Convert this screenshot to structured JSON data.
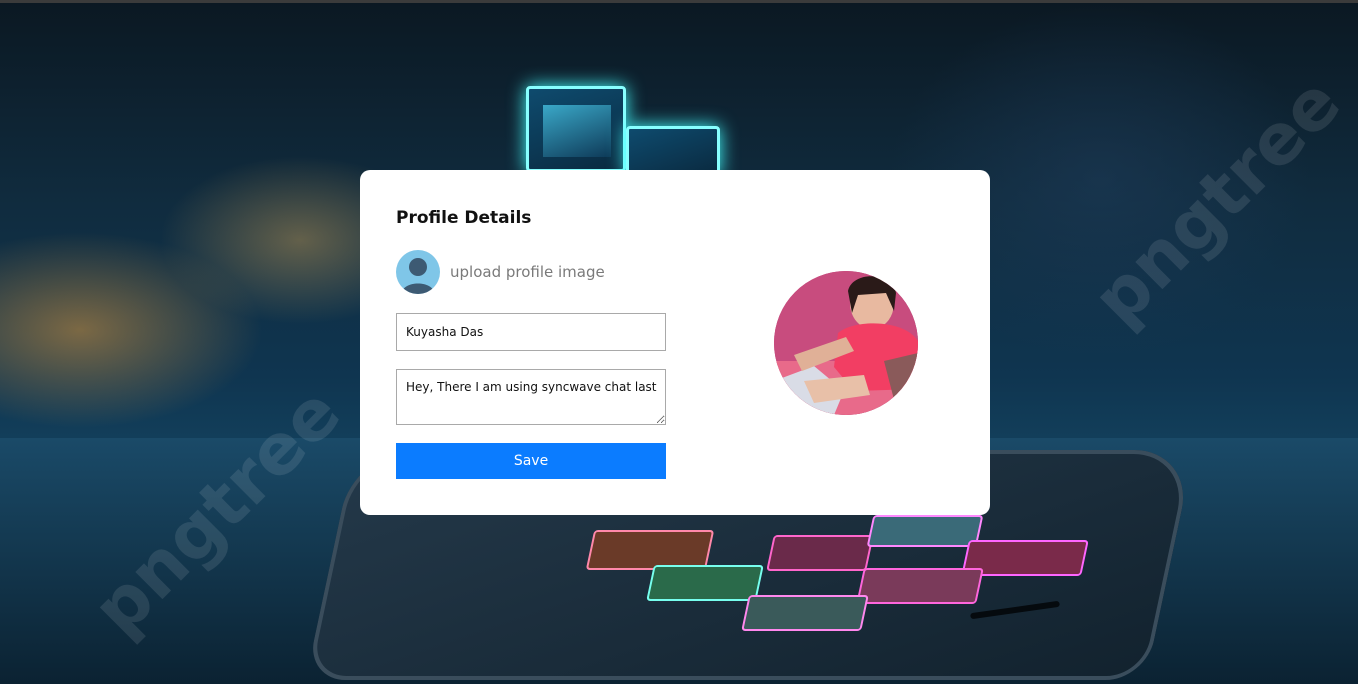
{
  "profile": {
    "title": "Profile Details",
    "upload_label": "upload profile image",
    "name_value": "Kuyasha Das",
    "about_value": "Hey, There I am using syncwave chat last",
    "save_label": "Save"
  },
  "icons": {
    "default_avatar": "person-silhouette-icon",
    "profile_photo": "profile-photo"
  },
  "colors": {
    "save_button": "#0b7cff",
    "card_background": "#ffffff",
    "avatar_background": "#7fc6e8"
  }
}
